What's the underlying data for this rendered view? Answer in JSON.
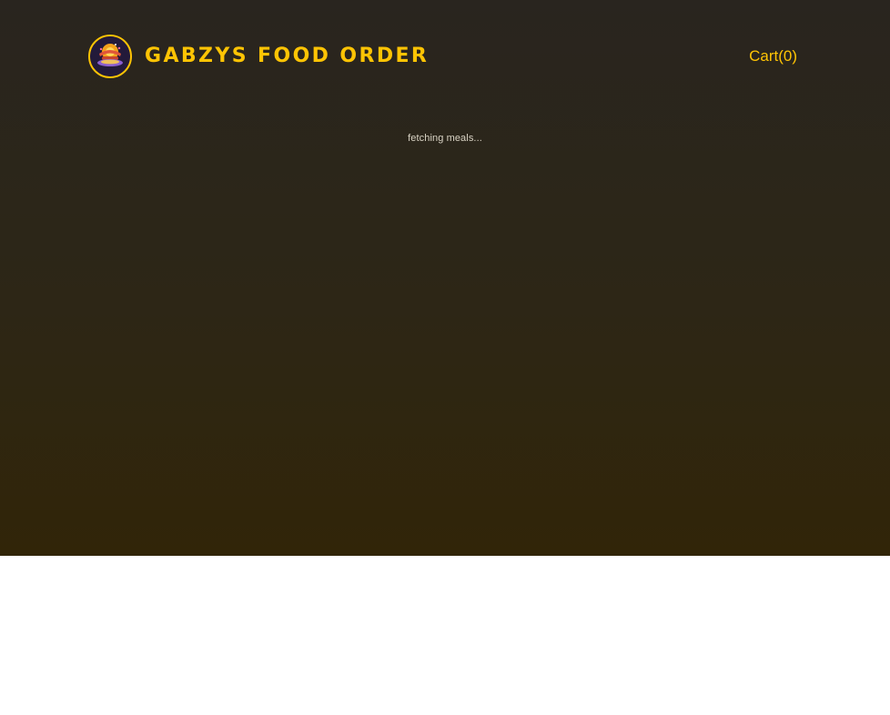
{
  "header": {
    "logo_icon": "food-plate-logo-icon",
    "title": "GABZYS FOOD ORDER",
    "cart_label": "Cart(0)"
  },
  "main": {
    "status_text": "fetching meals..."
  },
  "colors": {
    "accent": "#ffc404",
    "background_top": "#29251f",
    "background_bottom": "#312508",
    "page": "#ffffff",
    "status_text": "#d9d3c4"
  }
}
